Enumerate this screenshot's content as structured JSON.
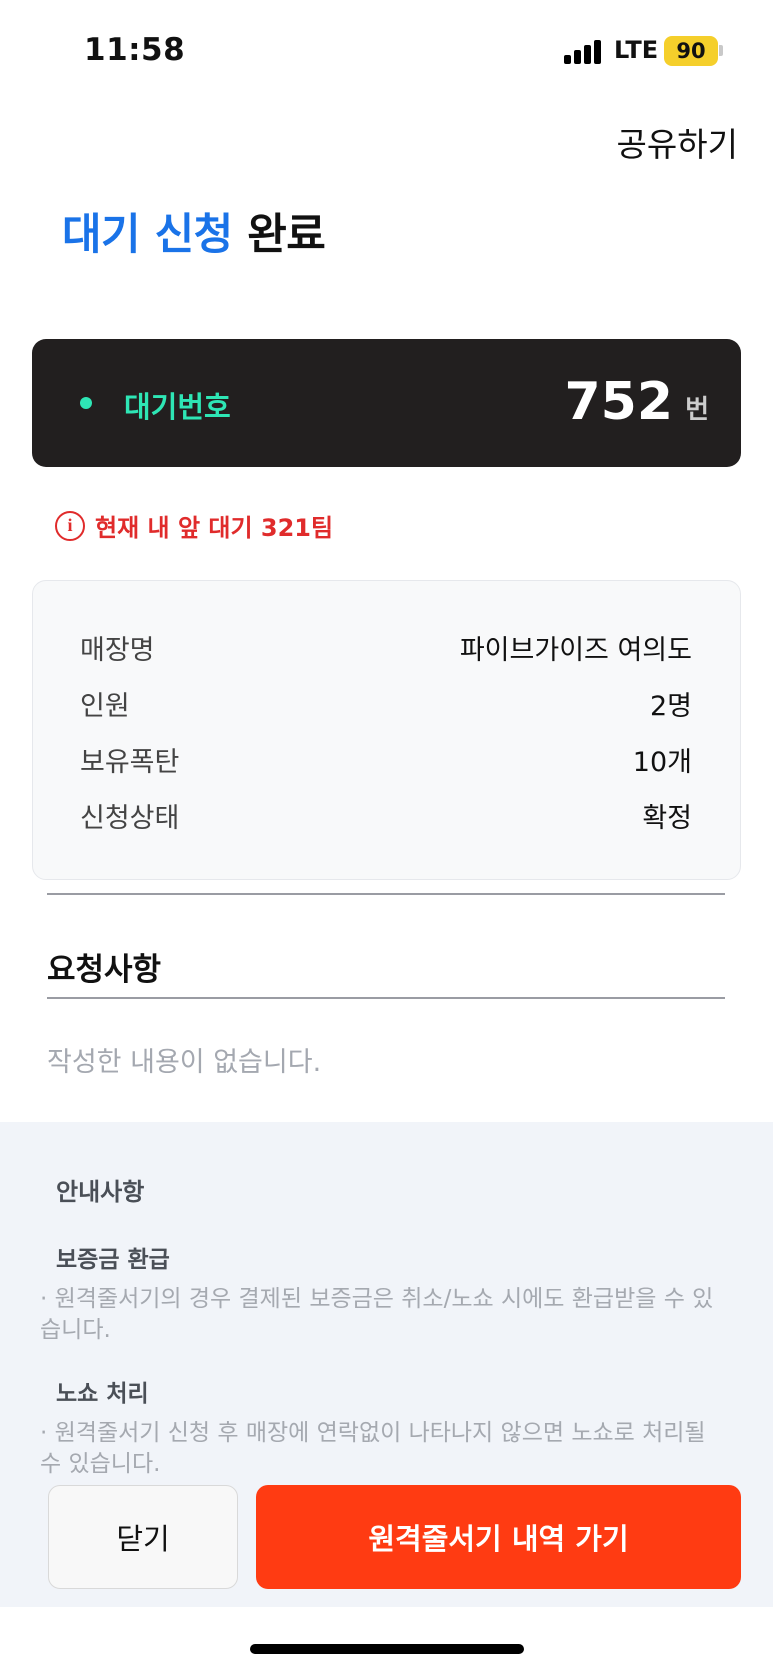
{
  "status_bar": {
    "time": "11:58",
    "network": "LTE",
    "battery": "90"
  },
  "header": {
    "share_label": "공유하기"
  },
  "title": {
    "accent": "대기 신청",
    "rest": "완료"
  },
  "waiting": {
    "label": "대기번호",
    "number": "752",
    "unit": "번"
  },
  "notice": "현재 내 앞 대기 321팀",
  "details": [
    {
      "key": "매장명",
      "value": "파이브가이즈 여의도"
    },
    {
      "key": "인원",
      "value": "2명"
    },
    {
      "key": "보유폭탄",
      "value": "10개"
    },
    {
      "key": "신청상태",
      "value": "확정"
    }
  ],
  "request": {
    "title": "요청사항",
    "empty_text": "작성한 내용이 없습니다."
  },
  "guide": {
    "title": "안내사항",
    "sections": [
      {
        "heading": "보증금 환급",
        "text": "· 원격줄서기의 경우 결제된 보증금은 취소/노쇼 시에도 환급받을 수 있습니다."
      },
      {
        "heading": "노쇼 처리",
        "text": "· 원격줄서기 신청 후 매장에 연락없이 나타나지 않으면 노쇼로 처리될 수 있습니다."
      }
    ]
  },
  "buttons": {
    "close": "닫기",
    "primary": "원격줄서기 내역 가기"
  },
  "colors": {
    "accent_blue": "#1a73e8",
    "mint": "#2ee6b5",
    "alert_red": "#e02b2b",
    "primary_orange": "#ff3b12"
  }
}
